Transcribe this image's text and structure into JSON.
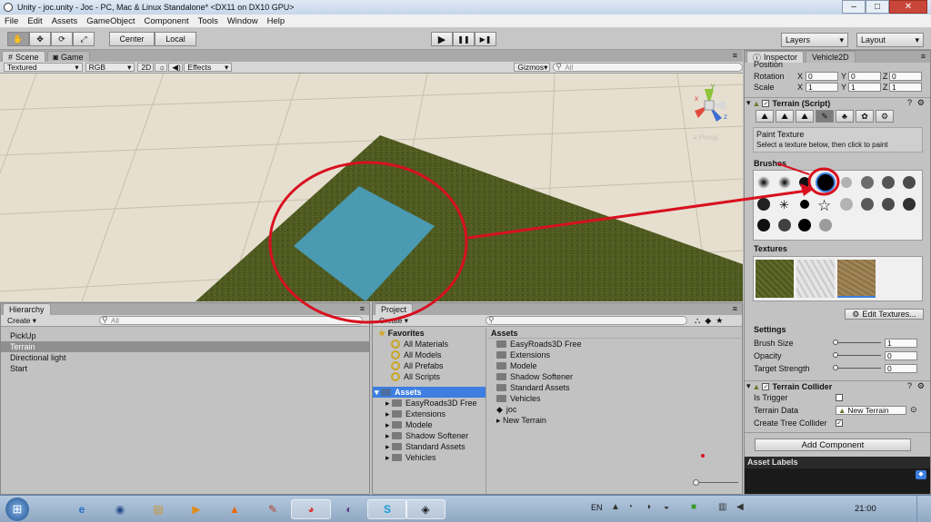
{
  "window": {
    "title": "Unity - joc.unity - Joc - PC, Mac & Linux Standalone* <DX11 on DX10 GPU>",
    "minimize": "–",
    "maximize": "□",
    "close": "✕"
  },
  "menu": [
    "File",
    "Edit",
    "Assets",
    "GameObject",
    "Component",
    "Tools",
    "Window",
    "Help"
  ],
  "toolbar": {
    "center": "Center",
    "local": "Local",
    "layers": "Layers",
    "layout": "Layout",
    "play": "▶",
    "pause": "❚❚",
    "step": "▶❚"
  },
  "scene": {
    "tabs": [
      "Scene",
      "Game"
    ],
    "shading": "Textured",
    "rgb": "RGB",
    "mode2d": "2D",
    "sun": "☼",
    "audio": "◀)",
    "effects": "Effects",
    "gizmos": "Gizmos",
    "search_placeholder": "All",
    "persp": "≡ Persp",
    "gizmo_axes": {
      "x": "x",
      "y": "y",
      "z": "z"
    }
  },
  "hierarchy": {
    "tab": "Hierarchy",
    "create": "Create",
    "search_placeholder": "All",
    "items": [
      "PickUp",
      "Terrain",
      "Directional light",
      "Start"
    ],
    "selected_index": 1
  },
  "project": {
    "tab": "Project",
    "create": "Create",
    "favorites_label": "Favorites",
    "favorites": [
      "All Materials",
      "All Models",
      "All Prefabs",
      "All Scripts"
    ],
    "assets_label": "Assets",
    "tree_assets": [
      "EasyRoads3D Free",
      "Extensions",
      "Modele",
      "Shadow Softener",
      "Standard Assets",
      "Vehicles"
    ],
    "breadcrumb": "Assets",
    "right_items": [
      "EasyRoads3D Free",
      "Extensions",
      "Modele",
      "Shadow Softener",
      "Standard Assets",
      "Vehicles",
      "joc",
      "New Terrain"
    ],
    "filter_icons": [
      "search-filter",
      "label-filter",
      "star-filter"
    ]
  },
  "inspector": {
    "tabs": [
      "Inspector",
      "Vehicle2D"
    ],
    "transform": {
      "position_label": "Position",
      "rotation_label": "Rotation",
      "scale_label": "Scale",
      "rotation": {
        "x": "0",
        "y": "0",
        "z": "0"
      },
      "scale": {
        "x": "1",
        "y": "1",
        "z": "1"
      },
      "axis_x": "X",
      "axis_y": "Y",
      "axis_z": "Z"
    },
    "terrain_script": {
      "title": "Terrain (Script)",
      "tool_title": "Paint Texture",
      "tool_hint": "Select a texture below, then click to paint"
    },
    "brushes_label": "Brushes",
    "textures_label": "Textures",
    "edit_textures": "Edit Textures...",
    "settings": {
      "label": "Settings",
      "brush_size_label": "Brush Size",
      "brush_size": "1",
      "opacity_label": "Opacity",
      "opacity": "0",
      "target_strength_label": "Target Strength",
      "target_strength": "0"
    },
    "collider": {
      "title": "Terrain Collider",
      "is_trigger_label": "Is Trigger",
      "terrain_data_label": "Terrain Data",
      "terrain_data": "New Terrain",
      "create_tree_colliders_label": "Create Tree Collider",
      "create_tree_colliders": true
    },
    "add_component": "Add Component",
    "asset_labels": "Asset Labels"
  },
  "taskbar": {
    "language": "EN",
    "clock": "21:00",
    "start": "⊞"
  },
  "colors": {
    "accent_selection": "#3d7ee0",
    "annotation_red": "#d8101f",
    "terrain_green": "#4f5a21",
    "water_blue": "#4aa0bf"
  }
}
